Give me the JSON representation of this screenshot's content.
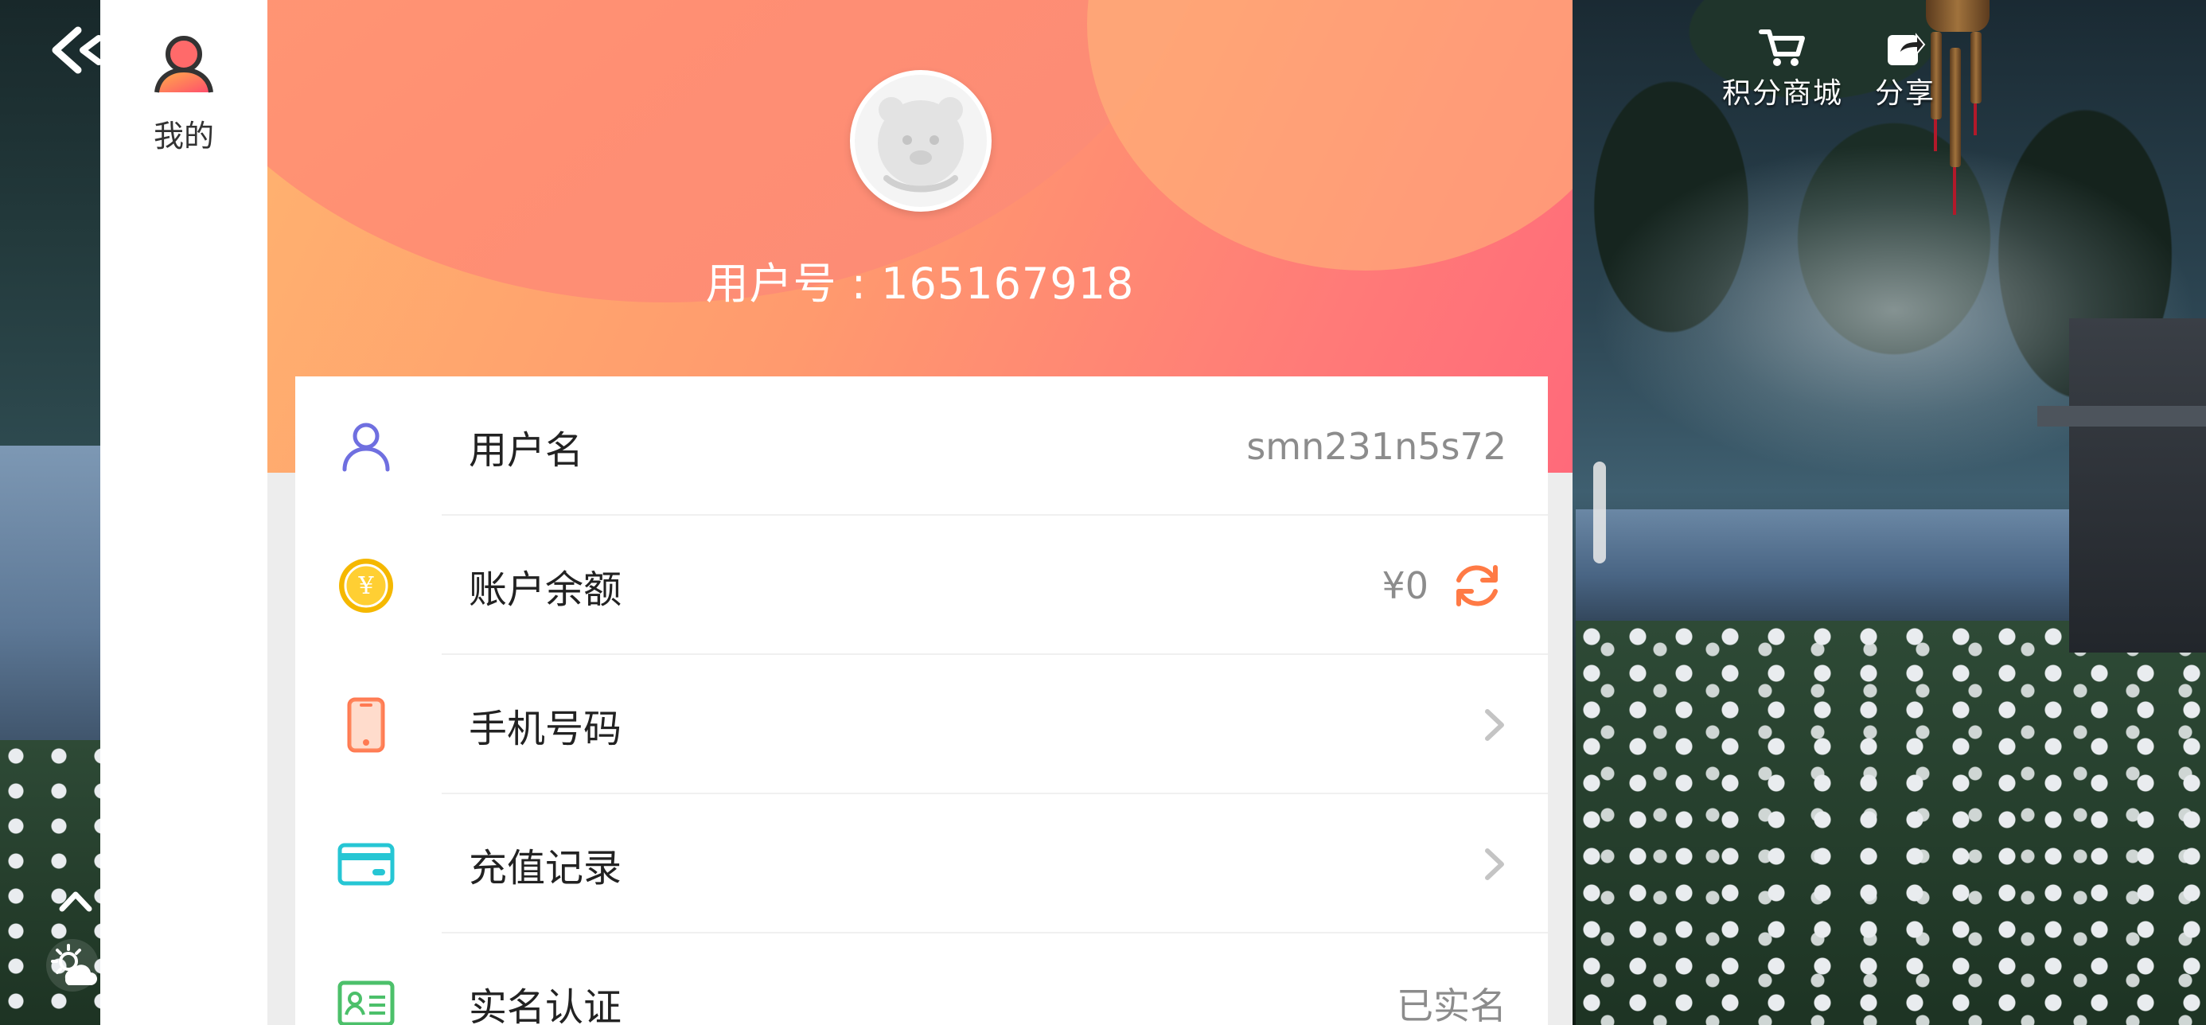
{
  "app": {
    "rail_tab_label": "我的",
    "accent_color": "#ff8a6e"
  },
  "game_tools": {
    "points_mall_label": "积分商城",
    "share_label": "分享"
  },
  "profile": {
    "user_id_text": "用户号 : 165167918"
  },
  "rows": [
    {
      "label": "用户名",
      "value": "smn231n5s72",
      "icon": "person-icon"
    },
    {
      "label": "账户余额",
      "value": "¥0",
      "icon": "coin-yen-icon",
      "action_icon": "refresh-icon"
    },
    {
      "label": "手机号码",
      "icon": "phone-icon",
      "action_icon": "chevron-right-icon"
    },
    {
      "label": "充值记录",
      "icon": "card-icon",
      "action_icon": "chevron-right-icon"
    },
    {
      "label": "实名认证",
      "value": "已实名",
      "icon": "id-card-icon"
    }
  ],
  "colors": {
    "person_icon": "#6f6fe0",
    "coin_icon": "#f5b800",
    "phone_icon": "#ff7a52",
    "card_icon": "#26c6d4",
    "id_icon": "#4cc06a",
    "refresh_icon": "#ff7a45"
  }
}
